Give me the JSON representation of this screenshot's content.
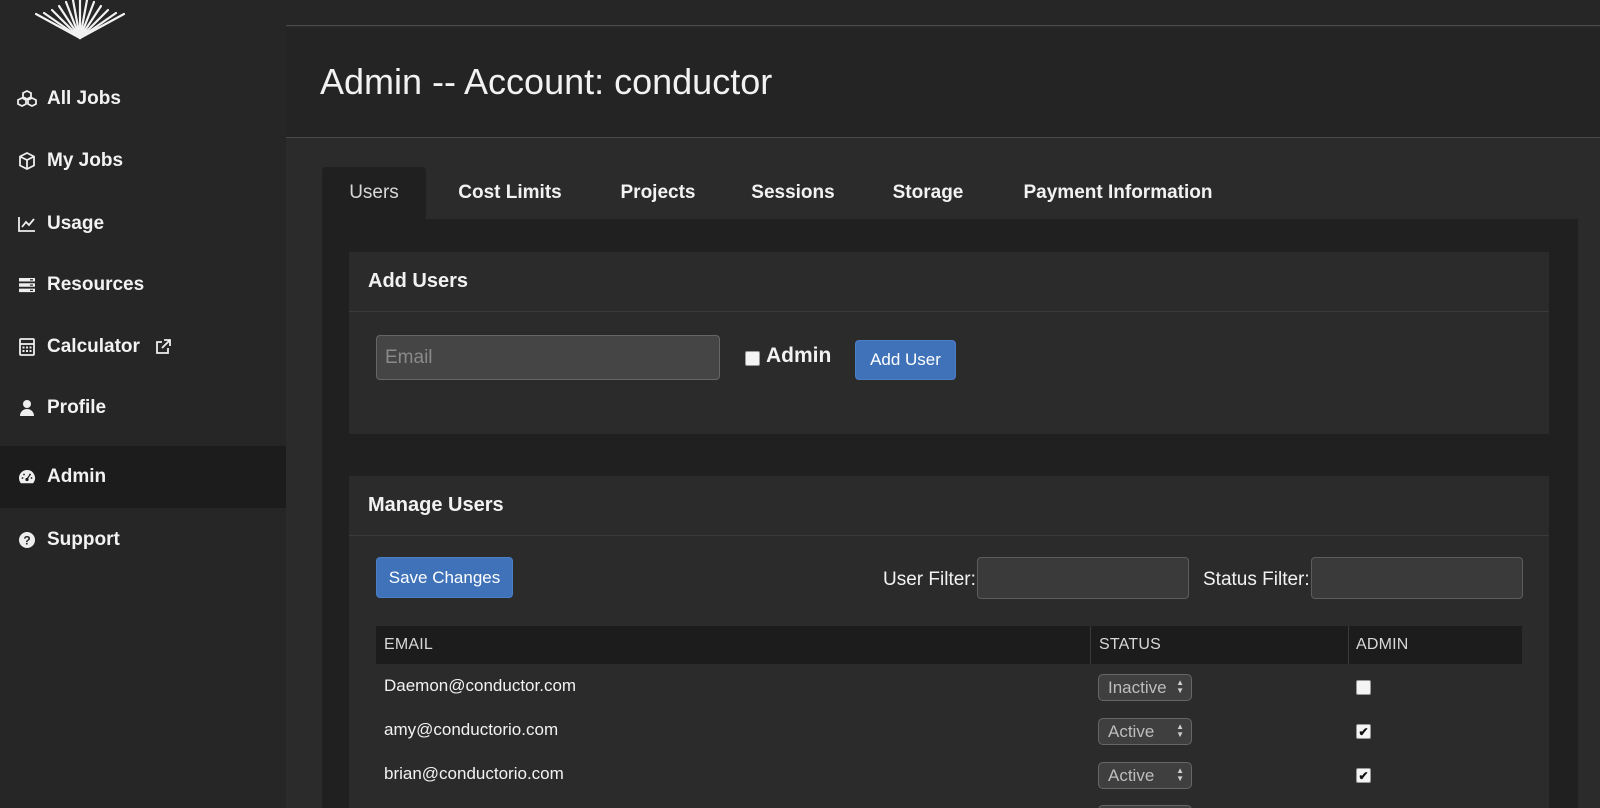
{
  "sidebar": {
    "items": [
      {
        "label": "All Jobs",
        "icon": "cubes-icon"
      },
      {
        "label": "My Jobs",
        "icon": "cube-icon"
      },
      {
        "label": "Usage",
        "icon": "line-chart-icon"
      },
      {
        "label": "Resources",
        "icon": "server-icon"
      },
      {
        "label": "Calculator",
        "icon": "calculator-icon",
        "external": true
      },
      {
        "label": "Profile",
        "icon": "user-icon"
      },
      {
        "label": "Admin",
        "icon": "dashboard-icon",
        "active": true
      },
      {
        "label": "Support",
        "icon": "question-circle-icon"
      }
    ]
  },
  "header": {
    "title": "Admin -- Account: conductor"
  },
  "tabs": [
    {
      "label": "Users",
      "active": true
    },
    {
      "label": "Cost Limits"
    },
    {
      "label": "Projects"
    },
    {
      "label": "Sessions"
    },
    {
      "label": "Storage"
    },
    {
      "label": "Payment Information"
    }
  ],
  "add_users": {
    "title": "Add Users",
    "email_placeholder": "Email",
    "admin_label": "Admin",
    "admin_checked": false,
    "button_label": "Add User"
  },
  "manage_users": {
    "title": "Manage Users",
    "save_label": "Save Changes",
    "user_filter_label": "User Filter:",
    "status_filter_label": "Status Filter:",
    "columns": [
      "EMAIL",
      "STATUS",
      "ADMIN"
    ],
    "rows": [
      {
        "email": "Daemon@conductor.com",
        "status": "Inactive",
        "admin": false
      },
      {
        "email": "amy@conductorio.com",
        "status": "Active",
        "admin": true
      },
      {
        "email": "brian@conductorio.com",
        "status": "Active",
        "admin": true
      }
    ]
  },
  "colors": {
    "accent": "#3f72b8",
    "sidebar_bg": "#262626",
    "panel_bg": "#202020"
  }
}
